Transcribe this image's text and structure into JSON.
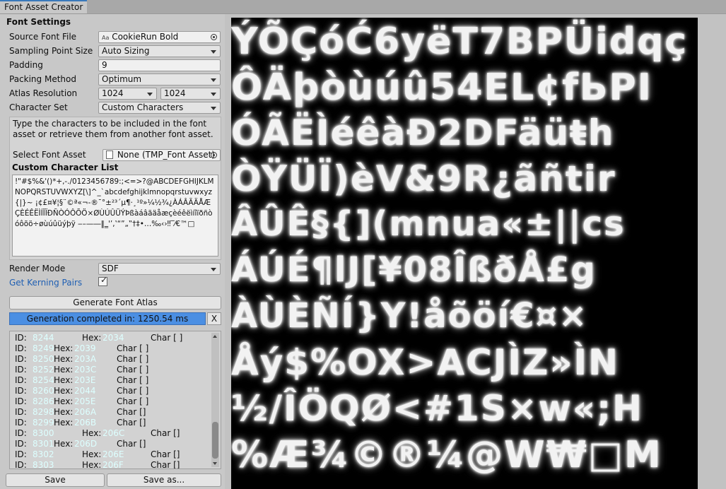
{
  "window": {
    "tab_title": "Font Asset Creator"
  },
  "settings": {
    "section_title": "Font Settings",
    "source_font_label": "Source Font File",
    "source_font_value": "CookieRun Bold",
    "source_font_icon": "Aa",
    "sampling_label": "Sampling Point Size",
    "sampling_value": "Auto Sizing",
    "padding_label": "Padding",
    "padding_value": "9",
    "packing_label": "Packing Method",
    "packing_value": "Optimum",
    "atlas_label": "Atlas Resolution",
    "atlas_width": "1024",
    "atlas_height": "1024",
    "charset_label": "Character Set",
    "charset_value": "Custom Characters",
    "help_text": "Type the characters to be included in the font asset or retrieve them from another font asset.",
    "select_asset_label": "Select Font Asset",
    "select_asset_value": "None (TMP_Font Asset)",
    "custom_list_label": "Custom Character List",
    "custom_list_value": "!\"#$%&'()*+,-./0123456789:;<=>?@ABCDEFGHIJKLMNOPQRSTUVWXYZ[\\]^_`abcdefghijklmnopqrstuvwxyz{|}~ ¡¢£¤¥¦§¨©ª«¬-®¯°±²³´µ¶·¸¹º»¼½¾¿ÀÁÂÃÄÅÆÇÈÉÊËÌÍÎÏÐÑÒÓÔÕÖ×ØÙÚÛÜÝÞßàáâãäåæçèéêëìíîïðñòóôõö÷øùúûüýþÿ ‒–—―‖‗'’‚‛“”„‟†‡•…‰‹›‼‾⁄€™□",
    "render_mode_label": "Render Mode",
    "render_mode_value": "SDF",
    "kerning_label": "Get Kerning Pairs",
    "kerning_checked": true,
    "generate_button": "Generate Font Atlas",
    "generation_status": "Generation completed in: 1250.54 ms",
    "clear_button": "X",
    "save_button": "Save",
    "save_as_button": "Save as..."
  },
  "log": [
    {
      "id_label": "ID:",
      "id": "8244",
      "hex_label": "Hex:",
      "hex": "2034",
      "char_label": "Char [ ]",
      "wide": true
    },
    {
      "id_label": "ID:",
      "id": "8249",
      "hex_label": "Hex:",
      "hex": "2039",
      "char_label": "Char [ ]",
      "wide": false
    },
    {
      "id_label": "ID:",
      "id": "8250",
      "hex_label": "Hex:",
      "hex": "203A",
      "char_label": "Char [ ]",
      "wide": false
    },
    {
      "id_label": "ID:",
      "id": "8252",
      "hex_label": "Hex:",
      "hex": "203C",
      "char_label": "Char [ ]",
      "wide": false
    },
    {
      "id_label": "ID:",
      "id": "8254",
      "hex_label": "Hex:",
      "hex": "203E",
      "char_label": "Char [ ]",
      "wide": false
    },
    {
      "id_label": "ID:",
      "id": "8260",
      "hex_label": "Hex:",
      "hex": "2044",
      "char_label": "Char [ ]",
      "wide": false
    },
    {
      "id_label": "ID:",
      "id": "8286",
      "hex_label": "Hex:",
      "hex": "205E",
      "char_label": "Char [ ]",
      "wide": false
    },
    {
      "id_label": "ID:",
      "id": "8298",
      "hex_label": "Hex:",
      "hex": "206A",
      "char_label": "Char []",
      "wide": false
    },
    {
      "id_label": "ID:",
      "id": "8299",
      "hex_label": "Hex:",
      "hex": "206B",
      "char_label": "Char []",
      "wide": false
    },
    {
      "id_label": "ID:",
      "id": "8300",
      "hex_label": "Hex:",
      "hex": "206C",
      "char_label": "Char []",
      "wide": true
    },
    {
      "id_label": "ID:",
      "id": "8301",
      "hex_label": "Hex:",
      "hex": "206D",
      "char_label": "Char []",
      "wide": false
    },
    {
      "id_label": "ID:",
      "id": "8302",
      "hex_label": "Hex:",
      "hex": "206E",
      "char_label": "Char []",
      "wide": true
    },
    {
      "id_label": "ID:",
      "id": "8303",
      "hex_label": "Hex:",
      "hex": "206F",
      "char_label": "Char []",
      "wide": true
    }
  ],
  "atlas": {
    "rows": [
      {
        "glyphs": "ÝÕÇóĆ6yëT7BPÜidqç",
        "size": 52
      },
      {
        "glyphs": "ÔÄþòùúû54EL¢fЬPI",
        "size": 52
      },
      {
        "glyphs": "ÓÃËÌéêàĐ2DFäüŧh",
        "size": 50
      },
      {
        "glyphs": "ÒŸÜÏ)èV&9R¿ãñtir",
        "size": 50
      },
      {
        "glyphs": "ÂÛÊ§{](mnua«±||cs",
        "size": 48
      },
      {
        "glyphs": "ÁÚÉ¶lJ[¥08ÎßðÅ£g",
        "size": 48
      },
      {
        "glyphs": "ÀÙÈÑÍ}Y!åõöí€¤×",
        "size": 48
      },
      {
        "glyphs": "Åý$%OX>ACJÌZ»ÌN",
        "size": 50
      },
      {
        "glyphs": "½/ÎÖQØ<#1S×w«;H",
        "size": 50
      },
      {
        "glyphs": "%Æ¾©®¼@W₩□M",
        "size": 52
      }
    ]
  }
}
